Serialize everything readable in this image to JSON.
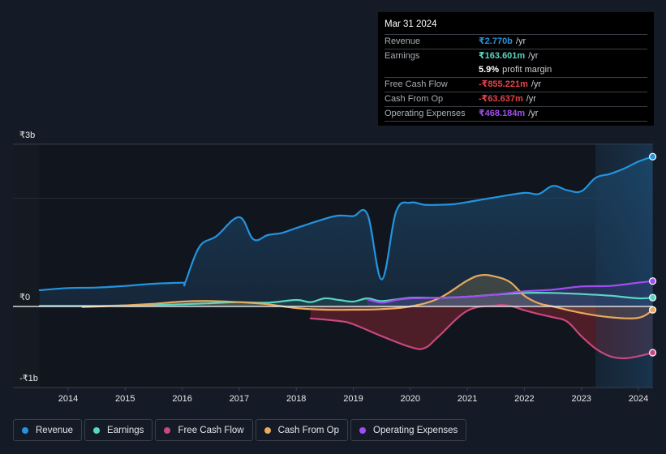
{
  "tooltip": {
    "date": "Mar 31 2024",
    "rows": [
      {
        "label": "Revenue",
        "value": "₹2.770b",
        "unit": "/yr",
        "color": "#2394df"
      },
      {
        "label": "Earnings",
        "value": "₹163.601m",
        "unit": "/yr",
        "color": "#58d6c4"
      },
      {
        "label": "",
        "value": "5.9%",
        "unit": "profit margin",
        "color": "#ffffff"
      },
      {
        "label": "Free Cash Flow",
        "value": "-₹855.221m",
        "unit": "/yr",
        "color": "#e5434b"
      },
      {
        "label": "Cash From Op",
        "value": "-₹63.637m",
        "unit": "/yr",
        "color": "#e5434b"
      },
      {
        "label": "Operating Expenses",
        "value": "₹468.184m",
        "unit": "/yr",
        "color": "#a14ef0"
      }
    ]
  },
  "legend": [
    {
      "label": "Revenue",
      "color": "#2394df"
    },
    {
      "label": "Earnings",
      "color": "#58d6c4"
    },
    {
      "label": "Free Cash Flow",
      "color": "#c8487f"
    },
    {
      "label": "Cash From Op",
      "color": "#e8a95c"
    },
    {
      "label": "Operating Expenses",
      "color": "#a14ef0"
    }
  ],
  "chart_data": {
    "type": "area",
    "title": "",
    "xlabel": "",
    "ylabel": "",
    "x_ticks": [
      "2014",
      "2015",
      "2016",
      "2017",
      "2018",
      "2019",
      "2020",
      "2021",
      "2022",
      "2023",
      "2024"
    ],
    "y_ticks": [
      {
        "value": 3,
        "label": "₹3b"
      },
      {
        "value": 0,
        "label": "₹0"
      },
      {
        "value": -1,
        "label": "-₹1b"
      }
    ],
    "y_unit": "₹ billions",
    "ylim": [
      -1.5,
      3
    ],
    "xlim": [
      2013.5,
      2024.25
    ],
    "highlight_from": 2023.25,
    "grid": true,
    "series": [
      {
        "name": "Revenue",
        "color": "#2394df",
        "points": [
          [
            2013.5,
            0.3
          ],
          [
            2014,
            0.34
          ],
          [
            2014.5,
            0.35
          ],
          [
            2015,
            0.38
          ],
          [
            2015.5,
            0.42
          ],
          [
            2016,
            0.44
          ],
          [
            2016.05,
            0.44
          ],
          [
            2016.3,
            1.1
          ],
          [
            2016.6,
            1.3
          ],
          [
            2017,
            1.65
          ],
          [
            2017.25,
            1.24
          ],
          [
            2017.5,
            1.32
          ],
          [
            2017.75,
            1.36
          ],
          [
            2018,
            1.45
          ],
          [
            2018.5,
            1.62
          ],
          [
            2018.75,
            1.68
          ],
          [
            2019,
            1.67
          ],
          [
            2019.25,
            1.7
          ],
          [
            2019.5,
            0.5
          ],
          [
            2019.75,
            1.75
          ],
          [
            2020,
            1.92
          ],
          [
            2020.25,
            1.88
          ],
          [
            2020.5,
            1.88
          ],
          [
            2020.75,
            1.89
          ],
          [
            2021,
            1.93
          ],
          [
            2021.5,
            2.02
          ],
          [
            2022,
            2.1
          ],
          [
            2022.25,
            2.08
          ],
          [
            2022.5,
            2.23
          ],
          [
            2022.75,
            2.15
          ],
          [
            2023,
            2.13
          ],
          [
            2023.25,
            2.38
          ],
          [
            2023.5,
            2.45
          ],
          [
            2023.75,
            2.55
          ],
          [
            2024,
            2.68
          ],
          [
            2024.25,
            2.77
          ]
        ]
      },
      {
        "name": "Earnings",
        "color": "#58d6c4",
        "points": [
          [
            2013.5,
            0.01
          ],
          [
            2014,
            0.01
          ],
          [
            2014.5,
            0.01
          ],
          [
            2015,
            0.02
          ],
          [
            2015.5,
            0.03
          ],
          [
            2016,
            0.04
          ],
          [
            2016.5,
            0.06
          ],
          [
            2017,
            0.08
          ],
          [
            2017.5,
            0.07
          ],
          [
            2018,
            0.12
          ],
          [
            2018.25,
            0.08
          ],
          [
            2018.5,
            0.15
          ],
          [
            2018.75,
            0.12
          ],
          [
            2019,
            0.09
          ],
          [
            2019.25,
            0.15
          ],
          [
            2019.5,
            0.1
          ],
          [
            2020,
            0.16
          ],
          [
            2020.5,
            0.16
          ],
          [
            2021,
            0.18
          ],
          [
            2021.5,
            0.22
          ],
          [
            2022,
            0.25
          ],
          [
            2022.5,
            0.25
          ],
          [
            2023,
            0.23
          ],
          [
            2023.5,
            0.2
          ],
          [
            2024,
            0.15
          ],
          [
            2024.25,
            0.164
          ]
        ]
      },
      {
        "name": "Free Cash Flow",
        "color": "#c8487f",
        "points": [
          [
            2018.25,
            -0.22
          ],
          [
            2018.75,
            -0.27
          ],
          [
            2019,
            -0.33
          ],
          [
            2019.5,
            -0.55
          ],
          [
            2020,
            -0.75
          ],
          [
            2020.25,
            -0.77
          ],
          [
            2020.5,
            -0.55
          ],
          [
            2021,
            -0.08
          ],
          [
            2021.5,
            0.02
          ],
          [
            2021.75,
            0.01
          ],
          [
            2022,
            -0.07
          ],
          [
            2022.25,
            -0.14
          ],
          [
            2022.5,
            -0.2
          ],
          [
            2022.75,
            -0.28
          ],
          [
            2023,
            -0.55
          ],
          [
            2023.25,
            -0.78
          ],
          [
            2023.5,
            -0.92
          ],
          [
            2023.75,
            -0.96
          ],
          [
            2024,
            -0.92
          ],
          [
            2024.25,
            -0.855
          ]
        ]
      },
      {
        "name": "Cash From Op",
        "color": "#e8a95c",
        "points": [
          [
            2014.25,
            -0.01
          ],
          [
            2015,
            0.02
          ],
          [
            2015.5,
            0.05
          ],
          [
            2016,
            0.09
          ],
          [
            2016.5,
            0.1
          ],
          [
            2017,
            0.08
          ],
          [
            2017.5,
            0.04
          ],
          [
            2018,
            -0.03
          ],
          [
            2018.5,
            -0.06
          ],
          [
            2019,
            -0.06
          ],
          [
            2019.5,
            -0.05
          ],
          [
            2020,
            0.0
          ],
          [
            2020.5,
            0.15
          ],
          [
            2021,
            0.48
          ],
          [
            2021.25,
            0.58
          ],
          [
            2021.5,
            0.55
          ],
          [
            2021.75,
            0.45
          ],
          [
            2022,
            0.2
          ],
          [
            2022.25,
            0.06
          ],
          [
            2022.5,
            0.0
          ],
          [
            2023,
            -0.12
          ],
          [
            2023.5,
            -0.2
          ],
          [
            2024,
            -0.21
          ],
          [
            2024.25,
            -0.064
          ]
        ]
      },
      {
        "name": "Operating Expenses",
        "color": "#a14ef0",
        "points": [
          [
            2019.25,
            0.13
          ],
          [
            2019.5,
            0.07
          ],
          [
            2019.75,
            0.12
          ],
          [
            2020,
            0.15
          ],
          [
            2020.5,
            0.16
          ],
          [
            2021,
            0.18
          ],
          [
            2021.5,
            0.22
          ],
          [
            2022,
            0.28
          ],
          [
            2022.5,
            0.31
          ],
          [
            2023,
            0.37
          ],
          [
            2023.5,
            0.38
          ],
          [
            2024,
            0.44
          ],
          [
            2024.25,
            0.468
          ]
        ]
      }
    ]
  }
}
